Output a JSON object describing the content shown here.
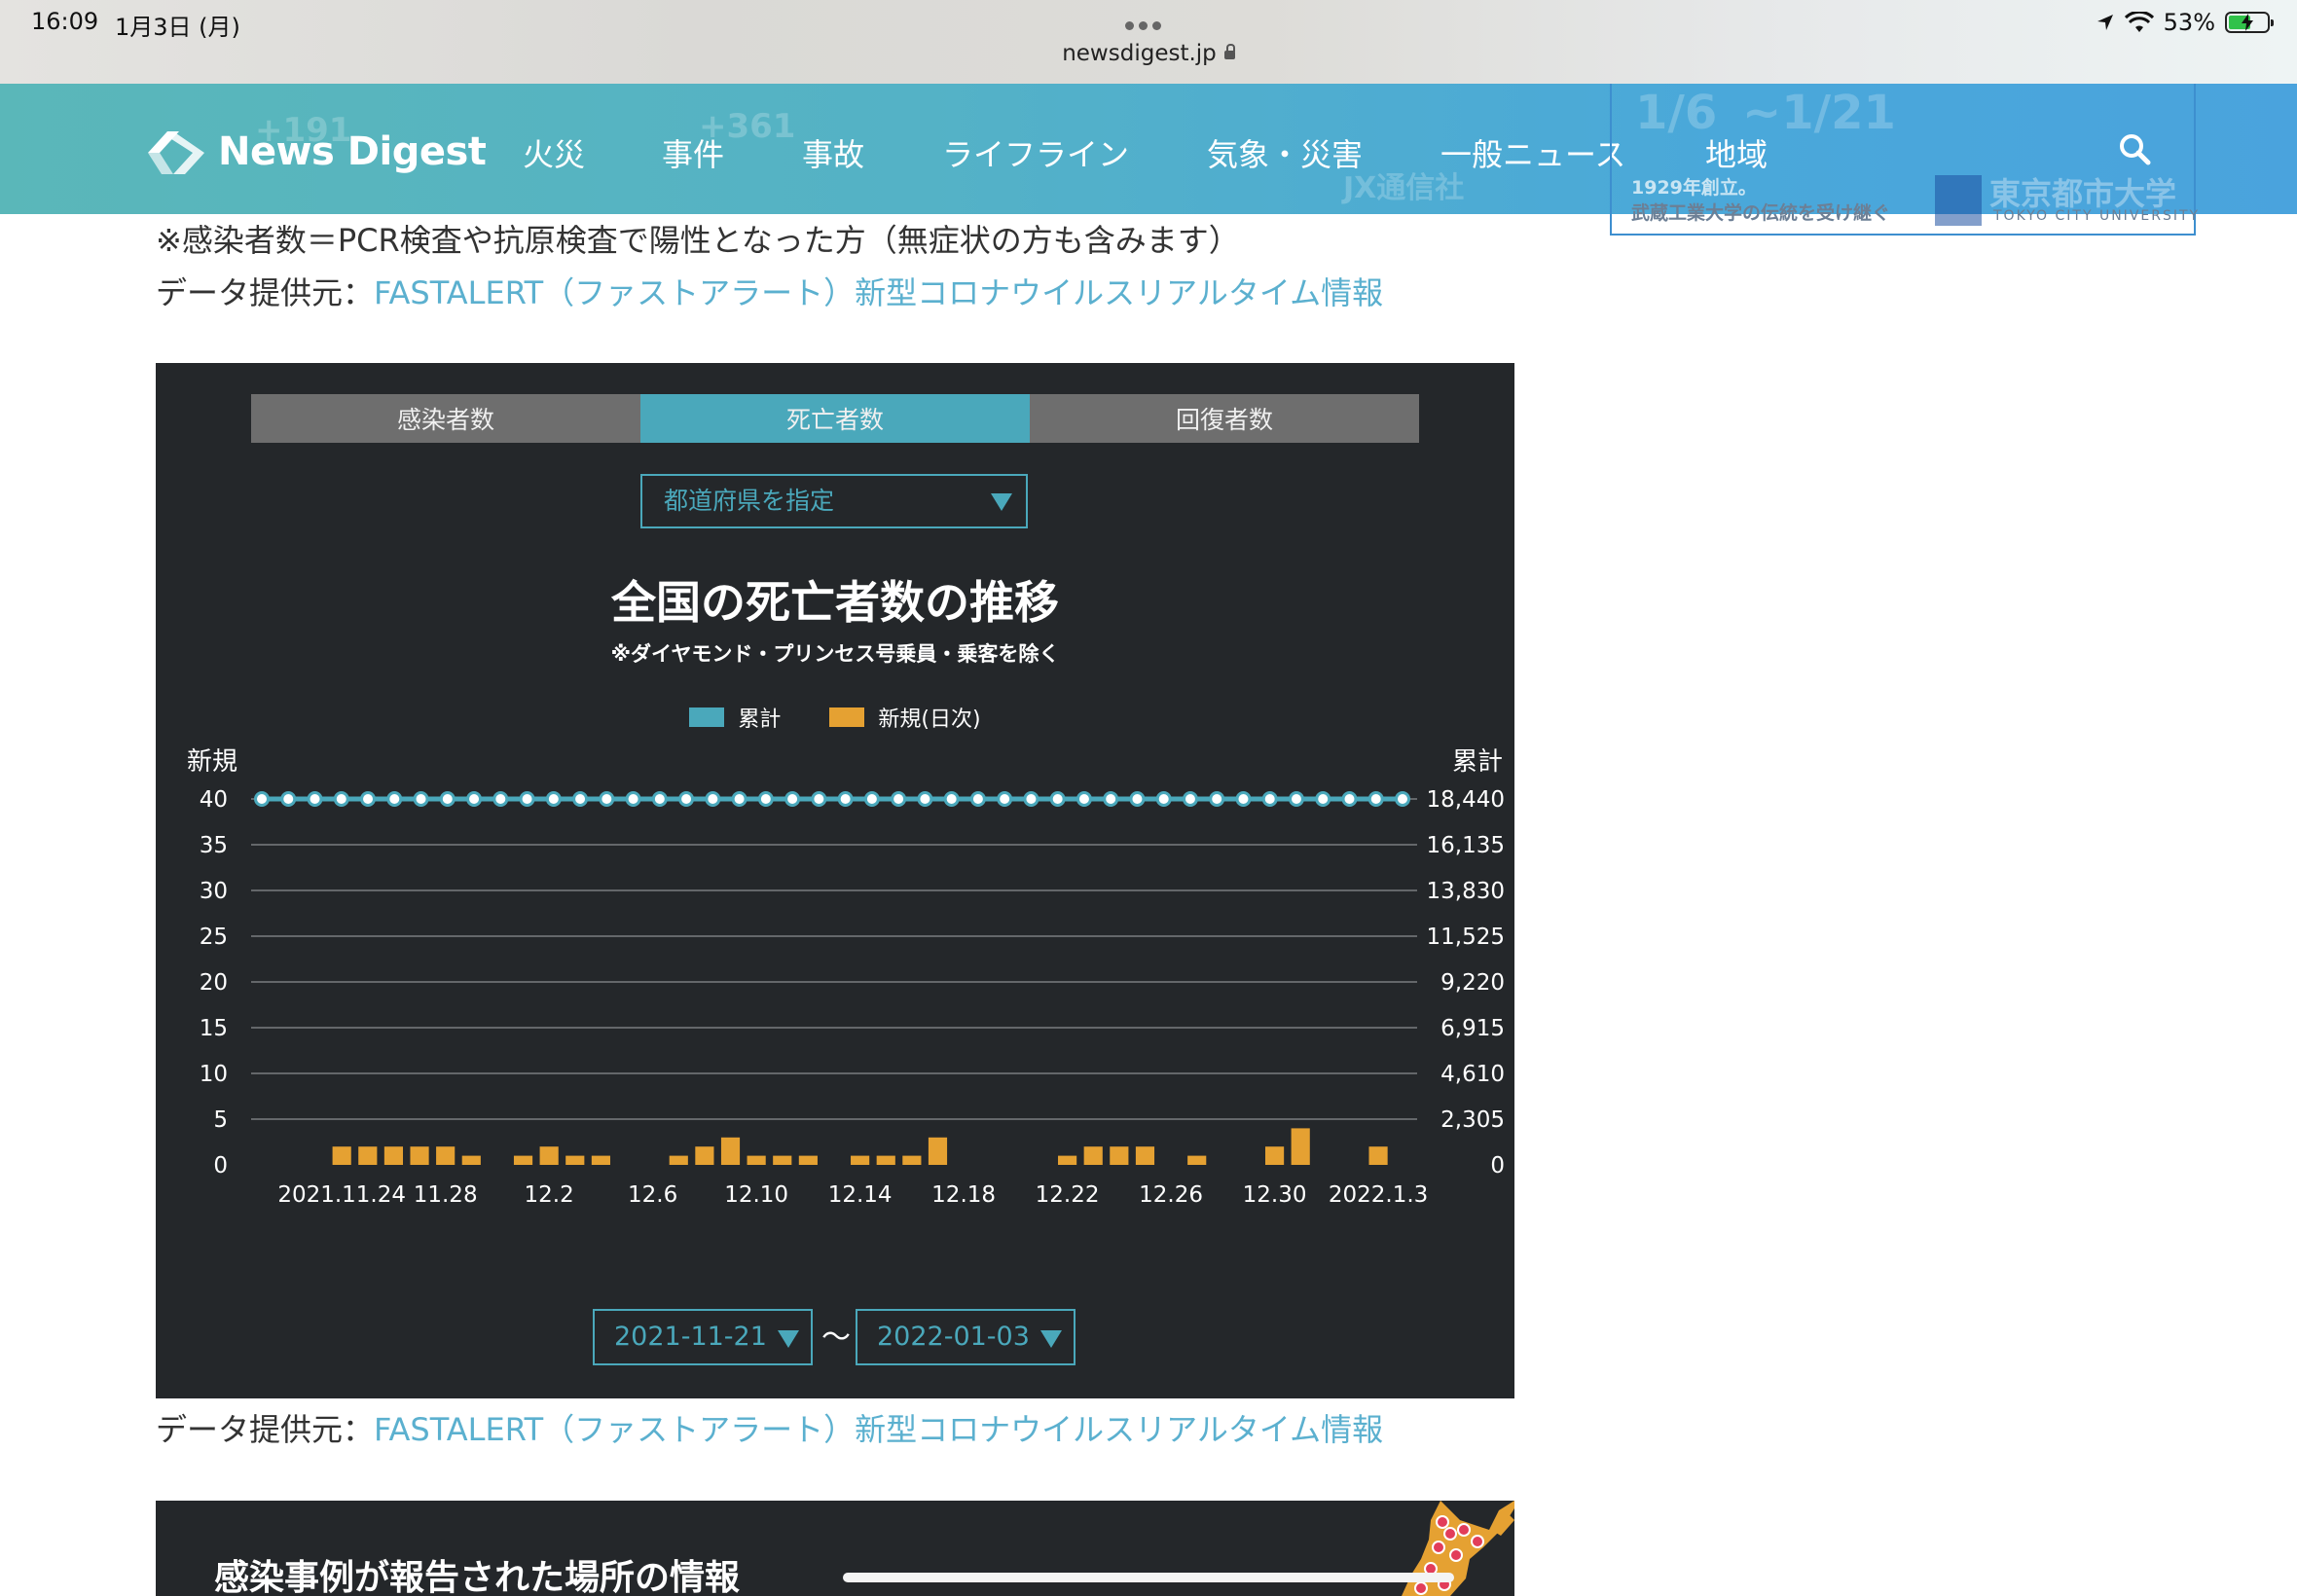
{
  "status_bar": {
    "time": "16:09",
    "date": "1月3日 (月)",
    "url": "newsdigest.jp",
    "battery": "53%"
  },
  "nav": {
    "logo": "News Digest",
    "items": [
      "火災",
      "事件",
      "事故",
      "ライフライン",
      "気象・災害",
      "一般ニュース",
      "地域"
    ],
    "ghost": [
      "+191",
      "+361",
      "JX通信社",
      "1/6",
      "~1/21"
    ]
  },
  "ad": {
    "line1": "1929年創立。",
    "line2": "武蔵工業大学の伝統を受け継ぐ",
    "university": "東京都市大学",
    "university_en": "TOKYO CITY UNIVERSITY"
  },
  "note": "※感染者数＝PCR検査や抗原検査で陽性となった方（無症状の方も含みます）",
  "source": {
    "label": "データ提供元：",
    "link": "FASTALERT（ファストアラート）新型コロナウイルスリアルタイム情報"
  },
  "widget": {
    "tabs": [
      {
        "label": "感染者数",
        "active": false
      },
      {
        "label": "死亡者数",
        "active": true
      },
      {
        "label": "回復者数",
        "active": false
      }
    ],
    "prefecture_select": "都道府県を指定",
    "date_from": "2021-11-21",
    "date_to": "2022-01-03",
    "date_separator": "〜"
  },
  "colors": {
    "cumulative": "#4aa8bb",
    "daily": "#e5a132",
    "panel": "#24272a",
    "link": "#5bb0cf"
  },
  "chart_data": {
    "type": "bar",
    "title": "全国の死亡者数の推移",
    "subtitle": "※ダイヤモンド・プリンセス号乗員・乗客を除く",
    "legend": [
      "累計",
      "新規(日次)"
    ],
    "left_axis": {
      "label": "新規",
      "ticks": [
        "0",
        "5",
        "10",
        "15",
        "20",
        "25",
        "30",
        "35",
        "40"
      ],
      "range": [
        0,
        40
      ]
    },
    "right_axis": {
      "label": "累計",
      "ticks": [
        "0",
        "2,305",
        "4,610",
        "6,915",
        "9,220",
        "11,525",
        "13,830",
        "16,135",
        "18,440"
      ],
      "range": [
        0,
        18440
      ]
    },
    "x": [
      "2021.11.24",
      "11.28",
      "12.2",
      "12.6",
      "12.10",
      "12.14",
      "12.18",
      "12.22",
      "12.26",
      "12.30",
      "2022.1.3"
    ],
    "series": [
      {
        "name": "新規(日次)",
        "type": "bar",
        "values": [
          0,
          0,
          0,
          2,
          2,
          2,
          2,
          2,
          1,
          0,
          1,
          2,
          1,
          1,
          0,
          0,
          1,
          2,
          3,
          1,
          1,
          1,
          0,
          1,
          1,
          1,
          3,
          0,
          0,
          0,
          0,
          1,
          2,
          2,
          2,
          0,
          1,
          0,
          0,
          2,
          4,
          0,
          0,
          2,
          0
        ]
      },
      {
        "name": "累計",
        "type": "line",
        "values": [
          18440,
          18440,
          18440,
          18440,
          18440,
          18440,
          18440,
          18440,
          18440,
          18440,
          18440,
          18440,
          18440,
          18440,
          18440,
          18440,
          18440,
          18440,
          18440,
          18440,
          18440,
          18440,
          18440,
          18440,
          18440,
          18440,
          18440,
          18440,
          18440,
          18440,
          18440,
          18440,
          18440,
          18440,
          18440,
          18440,
          18440,
          18440,
          18440,
          18440,
          18440,
          18440,
          18440,
          18440
        ]
      }
    ]
  },
  "map_panel": {
    "title": "感染事例が報告された場所の情報"
  }
}
